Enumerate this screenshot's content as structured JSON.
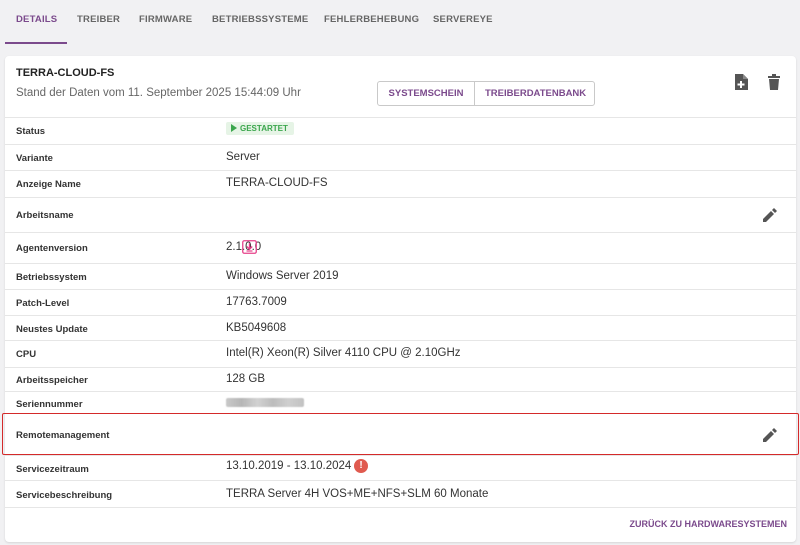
{
  "tabs": [
    {
      "label": "DETAILS",
      "active": true
    },
    {
      "label": "TREIBER"
    },
    {
      "label": "FIRMWARE"
    },
    {
      "label": "BETRIEBSSYSTEME"
    },
    {
      "label": "FEHLERBEHEBUNG"
    },
    {
      "label": "SERVEREYE"
    }
  ],
  "header": {
    "title": "TERRA-CLOUD-FS",
    "subtitle": "Stand der Daten vom 11. September 2025 15:44:09 Uhr",
    "buttons": {
      "systemschein": "SYSTEMSCHEIN",
      "treiberdatenbank": "TREIBERDATENBANK"
    },
    "icons": [
      "add-document-icon",
      "trash-icon"
    ]
  },
  "rows": {
    "status": {
      "label": "Status",
      "value": "GESTARTET"
    },
    "variante": {
      "label": "Variante",
      "value": "Server"
    },
    "anzeige_name": {
      "label": "Anzeige Name",
      "value": "TERRA-CLOUD-FS"
    },
    "arbeitsname": {
      "label": "Arbeitsname",
      "value": ""
    },
    "agentenversion": {
      "label": "Agentenversion",
      "value": "2.1.0.0"
    },
    "betriebssystem": {
      "label": "Betriebssystem",
      "value": "Windows Server 2019"
    },
    "patch_level": {
      "label": "Patch-Level",
      "value": "17763.7009"
    },
    "neustes_update": {
      "label": "Neustes Update",
      "value": "KB5049608"
    },
    "cpu": {
      "label": "CPU",
      "value": "Intel(R) Xeon(R) Silver 4110 CPU @ 2.10GHz"
    },
    "arbeitsspeicher": {
      "label": "Arbeitsspeicher",
      "value": "128 GB"
    },
    "seriennummer": {
      "label": "Seriennummer",
      "value": ""
    },
    "remotemanagement": {
      "label": "Remotemanagement",
      "value": ""
    },
    "servicezeitraum": {
      "label": "Servicezeitraum",
      "value": "13.10.2019 - 13.10.2024"
    },
    "servicebeschreibung": {
      "label": "Servicebeschreibung",
      "value": "TERRA Server 4H VOS+ME+NFS+SLM 60 Monate"
    }
  },
  "footer": {
    "back_link": "ZURÜCK ZU HARDWARESYSTEMEN"
  },
  "colors": {
    "accent": "#7b4a8c",
    "status_green": "#3ba64d",
    "warning_red": "#e05a4f",
    "highlight_border": "#d42a2a",
    "download_pink": "#e6418a"
  }
}
